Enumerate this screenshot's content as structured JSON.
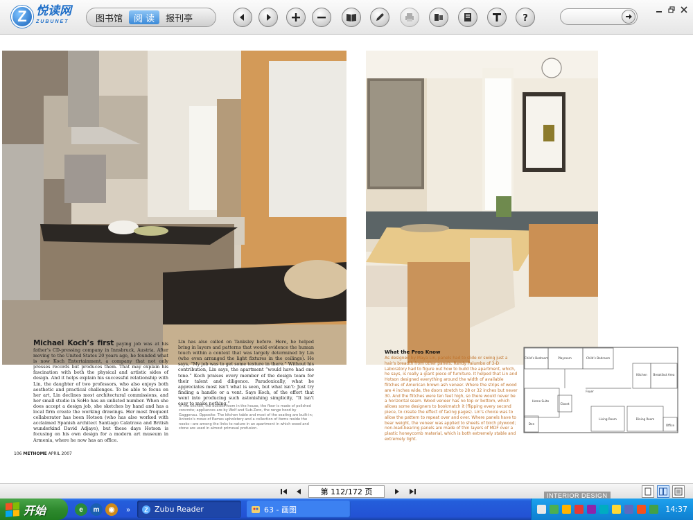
{
  "app": {
    "logo_text": "悦读网",
    "logo_sub": "ZUBUNET",
    "tabs": [
      {
        "label": "图书馆",
        "active": false
      },
      {
        "label": "阅 读",
        "active": true
      },
      {
        "label": "报刊亭",
        "active": false
      }
    ],
    "toolbar_icons": [
      "prev-page-icon",
      "next-page-icon",
      "zoom-in-icon",
      "zoom-out-icon",
      "book-view-icon",
      "annotate-pen-icon",
      "print-icon",
      "bookmark-icon",
      "contents-icon",
      "text-mode-icon",
      "help-icon"
    ],
    "search": {
      "value": ""
    }
  },
  "magazine": {
    "lead_in": "Michael Koch’s first",
    "col1": "paying job was at his father’s CD-pressing company in Innsbruck, Austria. After moving to the United States 20 years ago, he founded what is now Koch Entertainment, a company that not only presses records but produces them. That may explain his fascination with both the physical and artistic sides of design. And it helps explain his successful relationship with Lin, the daughter of two professors, who also enjoys both aesthetic and practical challenges. To be able to focus on her art, Lin declines most architectural commissions, and her small studio in SoHo has an unlisted number. When she does accept a design job, she sketches by hand and has a local firm create the working drawings. Her most frequent collaborator has been Hotson (who has also worked with acclaimed Spanish architect Santiago Calatrava and British wunderkind David Adjaye), but these days Hotson is focusing on his own design for a modern art museum in Armenia, where he now has an office.",
    "col2": "Lin has also called on Tanksley before. Here, he helped bring in layers and patterns that would evidence the human touch within a context that was largely determined by Lin (who even arranged the light fixtures in the ceilings). He says, “My job was to get some texture in there.” Without his contribution, Lin says, the apartment “would have had one tone.” Koch praises every member of the design team for their talent and diligence. Paradoxically, what he appreciates most isn’t what is seen, but what isn’t: Just try finding a handle or a vent. Says Koch, of the effort that went into producing such astonishing simplicity, “It isn’t easy to make nothing.”",
    "caption": "In the kitchen, the busiest room in the house, the floor is made of polished concrete; appliances are by Wolf and Sub-Zero, the range hood by Gaggenau. Opposite: The kitchen table and most of the seating are built-in; Antonio’s move of Eames upholstery and a collection of items reside the nooks—are among the links to nature in an apartment in which wood and stone are used in almost primeval profusion.",
    "folio_page": "106",
    "folio_mag": "METHOME",
    "folio_date": "APRIL 2007",
    "sidebar_title": "What the Pros Know",
    "sidebar_body": "As designed by Maya Lin, panels had to slide or swing just a hair’s breadth from other panels. Randy Palumbo of 3-D Laboratory had to figure out how to build the apartment, which, he says, is really a giant piece of furniture. It helped that Lin and Hotson designed everything around the width of available flitches of American brown ash veneer. Where the strips of wood are 4 inches wide, the doors stretch to 28 or 32 inches but never 30. And the flitches were ten feet high, so there would never be a horizontal seam. Wood veneer has no top or bottom, which allows some designers to bookmatch it (flipping every second piece, to create the effect of facing pages). Lin’s choice was to allow the pattern to repeat over and over. Where panels have to bear weight, the veneer was applied to sheets of birch plywood; non-load-bearing panels are made of thin layers of MDF over a plastic honeycomb material, which is both extremely stable and extremely light.",
    "floorplan_labels": {
      "childs_bedroom_1": "Child’s Bedroom",
      "playroom": "Playroom",
      "childs_bedroom_2": "Child’s Bedroom",
      "kitchen": "Kitchen",
      "breakfast_area": "Breakfast Area",
      "home_suite": "Home Suite",
      "closet": "Closet",
      "foyer": "Foyer",
      "den": "Den",
      "living_room": "Living Room",
      "dining_room": "Dining Room",
      "office": "Office"
    }
  },
  "pagination": {
    "page_label": "第 112/172 页"
  },
  "taskbar": {
    "start_label": "开始",
    "tasks": [
      {
        "label": "Zubu Reader",
        "active": true
      },
      {
        "label": "63 - 画图",
        "active": false
      }
    ],
    "clock": "14:37"
  },
  "watermark": "INTERIOR DESIGN",
  "colors": {
    "accent_blue": "#3b8ad8",
    "sidebar_orange": "#c0722a",
    "taskbar_blue": "#245edb",
    "start_green": "#2f8a2f"
  }
}
